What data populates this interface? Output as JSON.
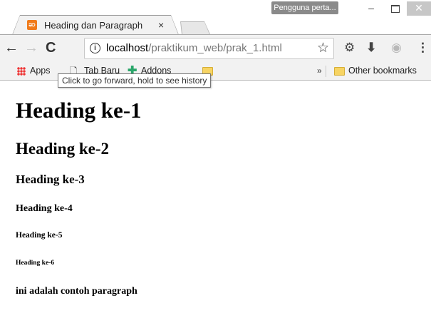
{
  "window": {
    "user_badge": "Pengguna perta...",
    "min_icon": "minimize-icon",
    "max_icon": "maximize-icon",
    "close_icon": "close-icon"
  },
  "tab": {
    "title": "Heading dan Paragraph",
    "close_glyph": "×",
    "favicon": "xampp-icon"
  },
  "toolbar": {
    "back_glyph": "←",
    "forward_glyph": "→",
    "reload_glyph": "C",
    "url_host": "localhost",
    "url_path": "/praktikum_web/prak_1.html",
    "star_glyph": "☆",
    "ext1_glyph": "⚙",
    "download_glyph": "⬇",
    "globe_glyph": "◉",
    "menu_glyph": "⋮"
  },
  "bookmarks": {
    "apps": "Apps",
    "tab_baru": "Tab Baru",
    "addons": "Addons",
    "overflow": "»",
    "other": "Other bookmarks"
  },
  "tooltip": "Click to go forward, hold to see history",
  "page": {
    "h1": "Heading ke-1",
    "h2": "Heading ke-2",
    "h3": "Heading ke-3",
    "h4": "Heading ke-4",
    "h5": "Heading ke-5",
    "h6": "Heading ke-6",
    "paragraph": "ini adalah contoh paragraph"
  }
}
